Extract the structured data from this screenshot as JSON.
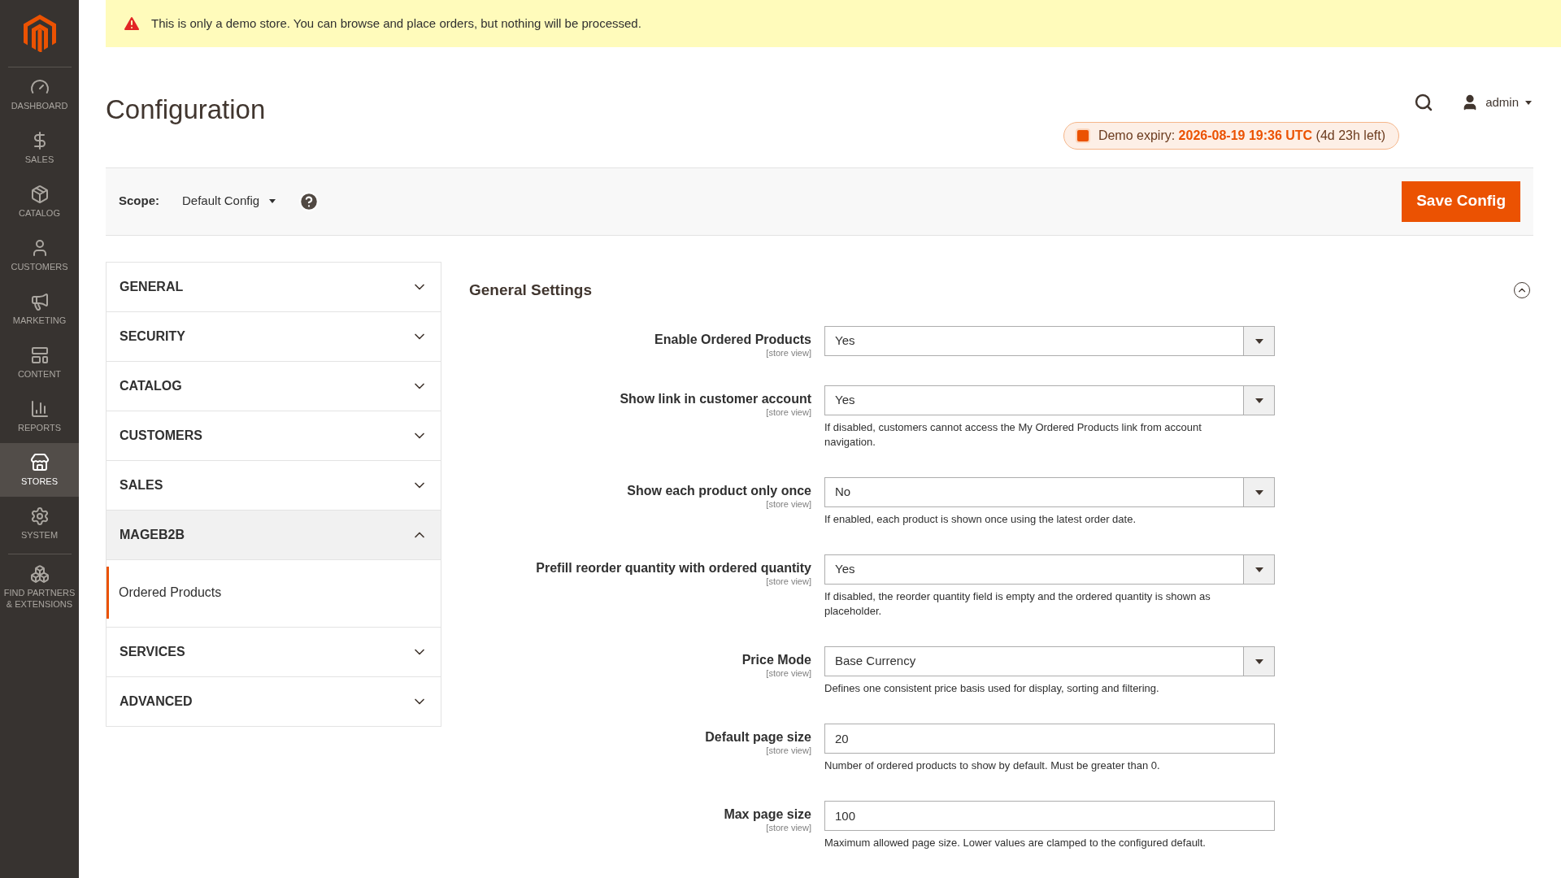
{
  "notice": "This is only a demo store. You can browse and place orders, but nothing will be processed.",
  "sidebar": {
    "items": [
      {
        "label": "DASHBOARD",
        "selected": false
      },
      {
        "label": "SALES",
        "selected": false
      },
      {
        "label": "CATALOG",
        "selected": false
      },
      {
        "label": "CUSTOMERS",
        "selected": false
      },
      {
        "label": "MARKETING",
        "selected": false
      },
      {
        "label": "CONTENT",
        "selected": false
      },
      {
        "label": "REPORTS",
        "selected": false
      },
      {
        "label": "STORES",
        "selected": true
      },
      {
        "label": "SYSTEM",
        "selected": false
      },
      {
        "label": "FIND PARTNERS & EXTENSIONS",
        "selected": false
      }
    ]
  },
  "page_title": "Configuration",
  "user": "admin",
  "demo_expiry": {
    "label": "Demo expiry:",
    "date": "2026-08-19 19:36 UTC",
    "remaining": "(4d 23h left)"
  },
  "scope": {
    "label": "Scope:",
    "value": "Default Config"
  },
  "save_button": "Save Config",
  "sections": [
    {
      "label": "GENERAL",
      "expanded": false
    },
    {
      "label": "SECURITY",
      "expanded": false
    },
    {
      "label": "CATALOG",
      "expanded": false
    },
    {
      "label": "CUSTOMERS",
      "expanded": false
    },
    {
      "label": "SALES",
      "expanded": false
    },
    {
      "label": "MAGEB2B",
      "expanded": true,
      "children": [
        {
          "label": "Ordered Products",
          "selected": true
        }
      ]
    },
    {
      "label": "SERVICES",
      "expanded": false
    },
    {
      "label": "ADVANCED",
      "expanded": false
    }
  ],
  "group": {
    "title": "General Settings",
    "expanded": true,
    "fields": [
      {
        "kind": "select",
        "label": "Enable Ordered Products",
        "scope": "[store view]",
        "value": "Yes"
      },
      {
        "kind": "select",
        "label": "Show link in customer account",
        "scope": "[store view]",
        "value": "Yes",
        "note": "If disabled, customers cannot access the My Ordered Products link from account navigation."
      },
      {
        "kind": "select",
        "label": "Show each product only once",
        "scope": "[store view]",
        "value": "No",
        "note": "If enabled, each product is shown once using the latest order date."
      },
      {
        "kind": "select",
        "label": "Prefill reorder quantity with ordered quantity",
        "scope": "[store view]",
        "value": "Yes",
        "note": "If disabled, the reorder quantity field is empty and the ordered quantity is shown as placeholder."
      },
      {
        "kind": "select",
        "label": "Price Mode",
        "scope": "[store view]",
        "value": "Base Currency",
        "note": "Defines one consistent price basis used for display, sorting and filtering."
      },
      {
        "kind": "text",
        "label": "Default page size",
        "scope": "[store view]",
        "value": "20",
        "note": "Number of ordered products to show by default. Must be greater than 0."
      },
      {
        "kind": "text",
        "label": "Max page size",
        "scope": "[store view]",
        "value": "100",
        "note": "Maximum allowed page size. Lower values are clamped to the configured default."
      }
    ]
  }
}
